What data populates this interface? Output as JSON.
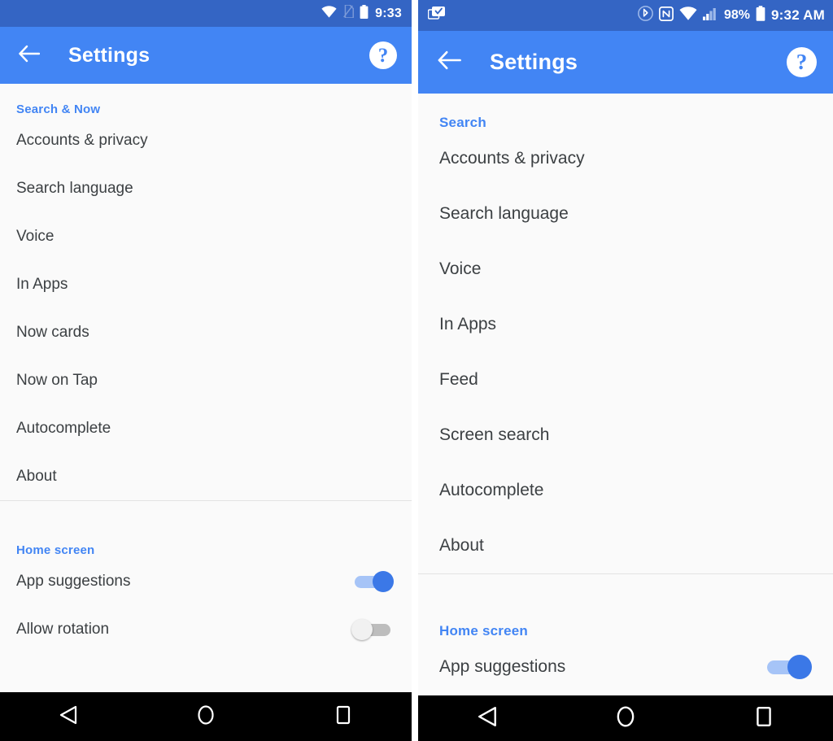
{
  "panels": {
    "left": {
      "statusbar": {
        "time": "9:33",
        "icons": [
          "wifi-icon",
          "no-sim-icon",
          "battery-icon"
        ]
      },
      "appbar": {
        "back_icon": "arrow-back-icon",
        "title": "Settings",
        "help_icon": "help-circle-icon",
        "help_label": "?"
      },
      "sections": [
        {
          "header": "Search & Now",
          "items": [
            {
              "label": "Accounts & privacy",
              "type": "link"
            },
            {
              "label": "Search language",
              "type": "link"
            },
            {
              "label": "Voice",
              "type": "link"
            },
            {
              "label": "In Apps",
              "type": "link"
            },
            {
              "label": "Now cards",
              "type": "link"
            },
            {
              "label": "Now on Tap",
              "type": "link"
            },
            {
              "label": "Autocomplete",
              "type": "link"
            },
            {
              "label": "About",
              "type": "link"
            }
          ]
        },
        {
          "header": "Home screen",
          "items": [
            {
              "label": "App suggestions",
              "type": "toggle",
              "state": "on"
            },
            {
              "label": "Allow rotation",
              "type": "toggle",
              "state": "off"
            }
          ]
        }
      ],
      "navbar": {
        "back": "back-triangle-icon",
        "home": "home-circle-icon",
        "recents": "recents-square-icon"
      }
    },
    "right": {
      "statusbar": {
        "time": "9:32 AM",
        "battery_percent": "98%",
        "left_icons": [
          "screenshot-icon"
        ],
        "icons": [
          "bluetooth-icon",
          "nfc-icon",
          "wifi-icon",
          "signal-bars-icon",
          "battery-icon"
        ]
      },
      "appbar": {
        "back_icon": "arrow-back-icon",
        "title": "Settings",
        "help_icon": "help-circle-icon",
        "help_label": "?"
      },
      "sections": [
        {
          "header": "Search",
          "items": [
            {
              "label": "Accounts & privacy",
              "type": "link"
            },
            {
              "label": "Search language",
              "type": "link"
            },
            {
              "label": "Voice",
              "type": "link"
            },
            {
              "label": "In Apps",
              "type": "link"
            },
            {
              "label": "Feed",
              "type": "link"
            },
            {
              "label": "Screen search",
              "type": "link"
            },
            {
              "label": "Autocomplete",
              "type": "link"
            },
            {
              "label": "About",
              "type": "link"
            }
          ]
        },
        {
          "header": "Home screen",
          "items": [
            {
              "label": "App suggestions",
              "type": "toggle",
              "state": "on"
            }
          ]
        }
      ],
      "navbar": {
        "back": "back-triangle-icon",
        "home": "home-circle-icon",
        "recents": "recents-square-icon"
      }
    }
  },
  "colors": {
    "statusbar": "#3465c4",
    "appbar": "#4285f4",
    "accent": "#4285f4",
    "background": "#fafafa",
    "text": "#3c4043",
    "toggle_on": "#3b78e7",
    "toggle_off": "#bdbdbd",
    "navbar": "#000000"
  }
}
